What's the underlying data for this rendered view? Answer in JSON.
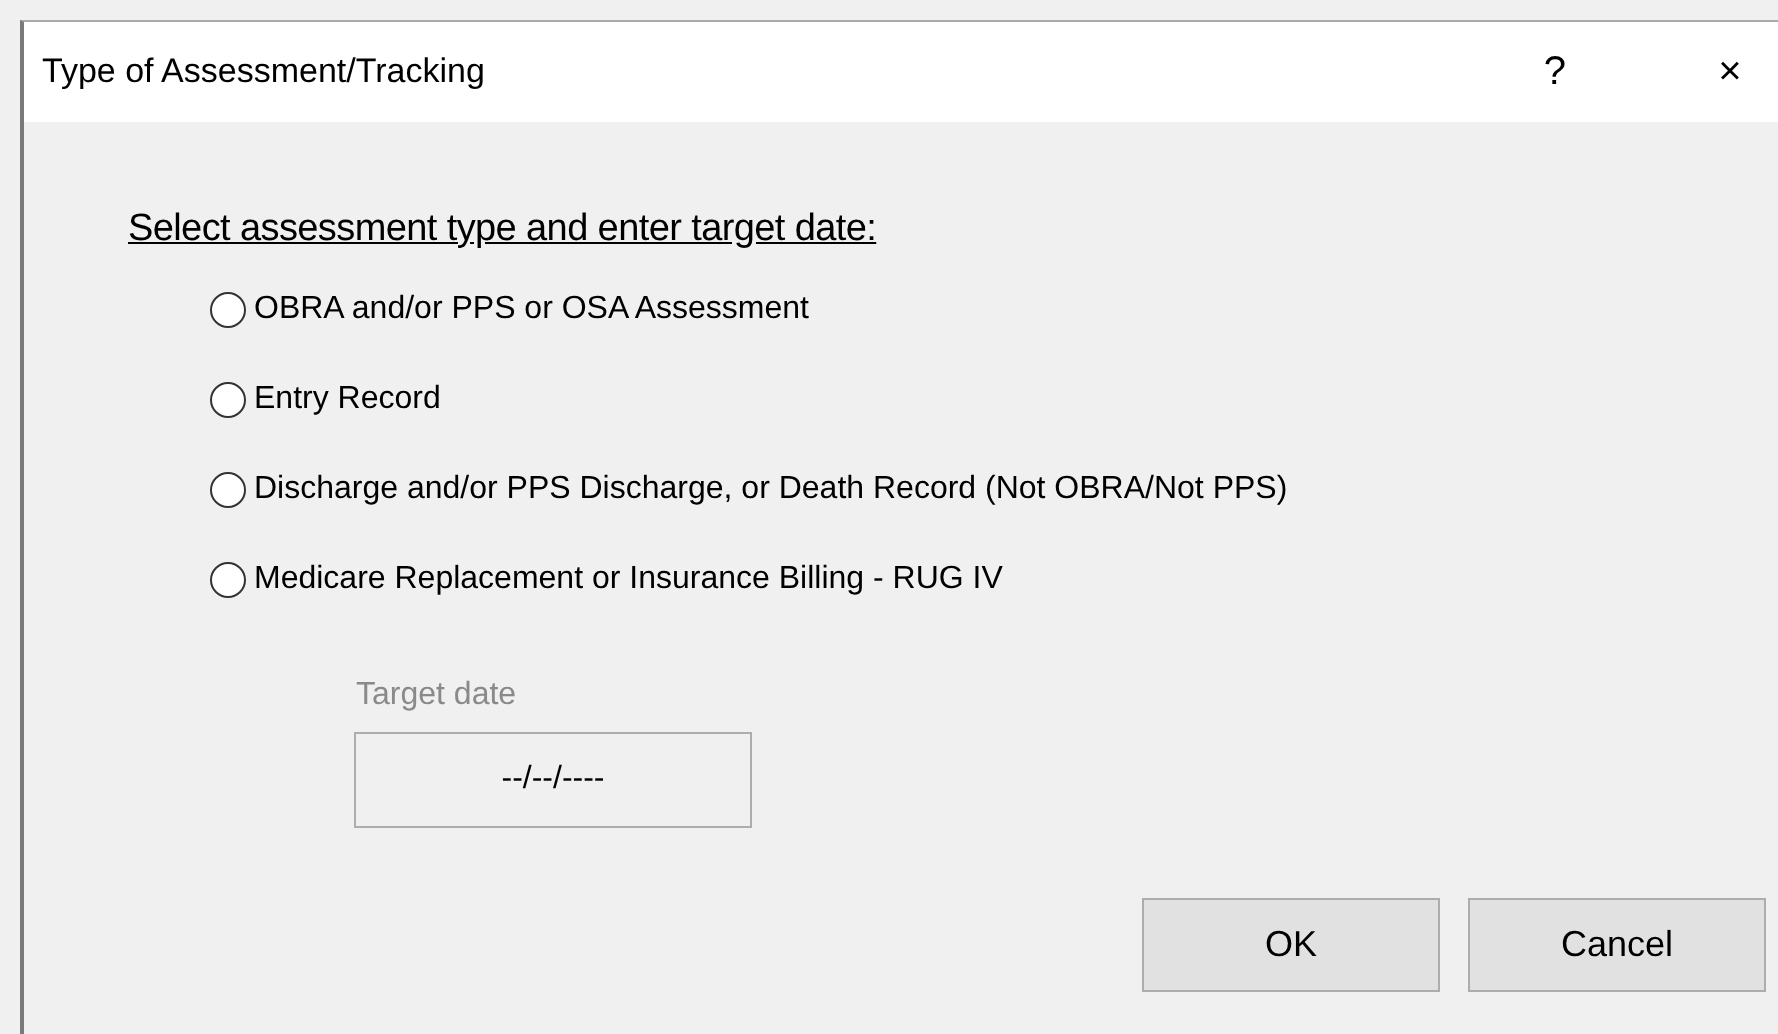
{
  "window": {
    "title": "Type of Assessment/Tracking",
    "help_button": "?",
    "close_button": "×"
  },
  "prompt": "Select assessment type and enter target date:",
  "options": [
    {
      "label": "OBRA and/or PPS or OSA Assessment",
      "selected": false
    },
    {
      "label": "Entry Record",
      "selected": false
    },
    {
      "label": "Discharge and/or PPS Discharge, or Death Record (Not OBRA/Not PPS)",
      "selected": false
    },
    {
      "label": "Medicare Replacement or Insurance Billing - RUG IV",
      "selected": false
    }
  ],
  "target_date": {
    "label": "Target date",
    "value": "--/--/----",
    "disabled": true
  },
  "buttons": [
    "OK",
    "Cancel"
  ]
}
